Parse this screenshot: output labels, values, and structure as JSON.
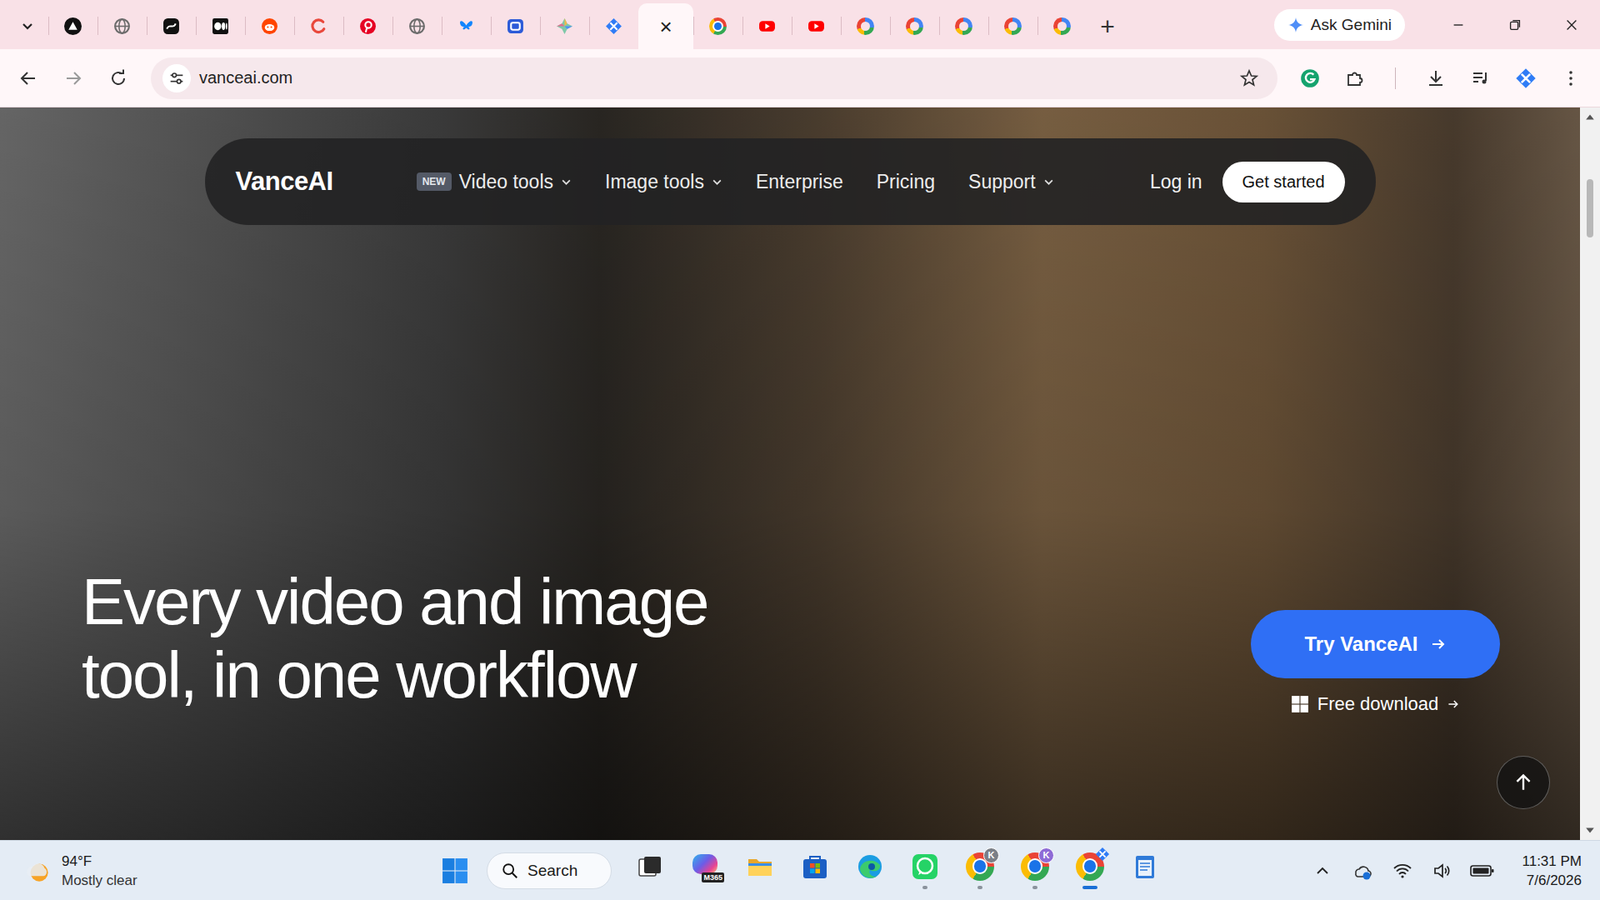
{
  "browser": {
    "tabs": [
      {
        "kind": "vercel",
        "selected": false
      },
      {
        "kind": "globe",
        "selected": false
      },
      {
        "kind": "dark",
        "selected": false
      },
      {
        "kind": "medium",
        "selected": false
      },
      {
        "kind": "reddit",
        "selected": false
      },
      {
        "kind": "ring",
        "selected": false
      },
      {
        "kind": "pinterest",
        "selected": false
      },
      {
        "kind": "globe",
        "selected": false
      },
      {
        "kind": "bluesky",
        "selected": false
      },
      {
        "kind": "meet",
        "selected": false
      },
      {
        "kind": "gemini",
        "selected": false
      },
      {
        "kind": "vance",
        "selected": false
      },
      {
        "selected": true
      },
      {
        "kind": "chrome",
        "selected": false
      },
      {
        "kind": "youtube",
        "selected": false
      },
      {
        "kind": "youtube",
        "selected": false
      },
      {
        "kind": "google",
        "selected": false
      },
      {
        "kind": "google",
        "selected": false
      },
      {
        "kind": "google",
        "selected": false
      },
      {
        "kind": "google",
        "selected": false
      },
      {
        "kind": "google",
        "selected": false
      }
    ],
    "close": "×",
    "new_tab": "+",
    "ask": "Ask Gemini",
    "address": "vanceai.com"
  },
  "page": {
    "logo": "VanceAI",
    "nav": [
      {
        "label": "Video tools",
        "badge": "NEW",
        "kind": "menu"
      },
      {
        "label": "Image tools",
        "kind": "menu"
      },
      {
        "label": "Enterprise",
        "kind": "link"
      },
      {
        "label": "Pricing",
        "kind": "link"
      },
      {
        "label": "Support",
        "kind": "menu"
      }
    ],
    "login": "Log in",
    "cta": "Get started",
    "headline": [
      "Every video and image",
      "tool, in one workflow"
    ],
    "try": "Try VanceAI",
    "download": "Free download"
  },
  "taskbar": {
    "weather": {
      "temp": "94°F",
      "sky": "Mostly clear"
    },
    "search": "Search",
    "apps": [
      {
        "kind": "taskview",
        "running": false,
        "selected": false
      },
      {
        "kind": "m365",
        "label": "M365",
        "running": false,
        "selected": false
      },
      {
        "kind": "explorer",
        "running": false,
        "selected": false
      },
      {
        "kind": "store",
        "running": false,
        "selected": false
      },
      {
        "kind": "edge",
        "running": false,
        "selected": false
      },
      {
        "kind": "whatsapp",
        "running": true,
        "selected": false
      },
      {
        "kind": "chrome",
        "badge": "K",
        "color": "#7a7f87",
        "running": true,
        "selected": false
      },
      {
        "kind": "chrome",
        "badge": "K",
        "color": "#8e6bd6",
        "running": true,
        "selected": false
      },
      {
        "kind": "chrome-vance",
        "running": true,
        "selected": true
      },
      {
        "kind": "notepad",
        "running": false,
        "selected": false
      }
    ],
    "time": "11:31 PM",
    "date": "7/6/2026"
  }
}
